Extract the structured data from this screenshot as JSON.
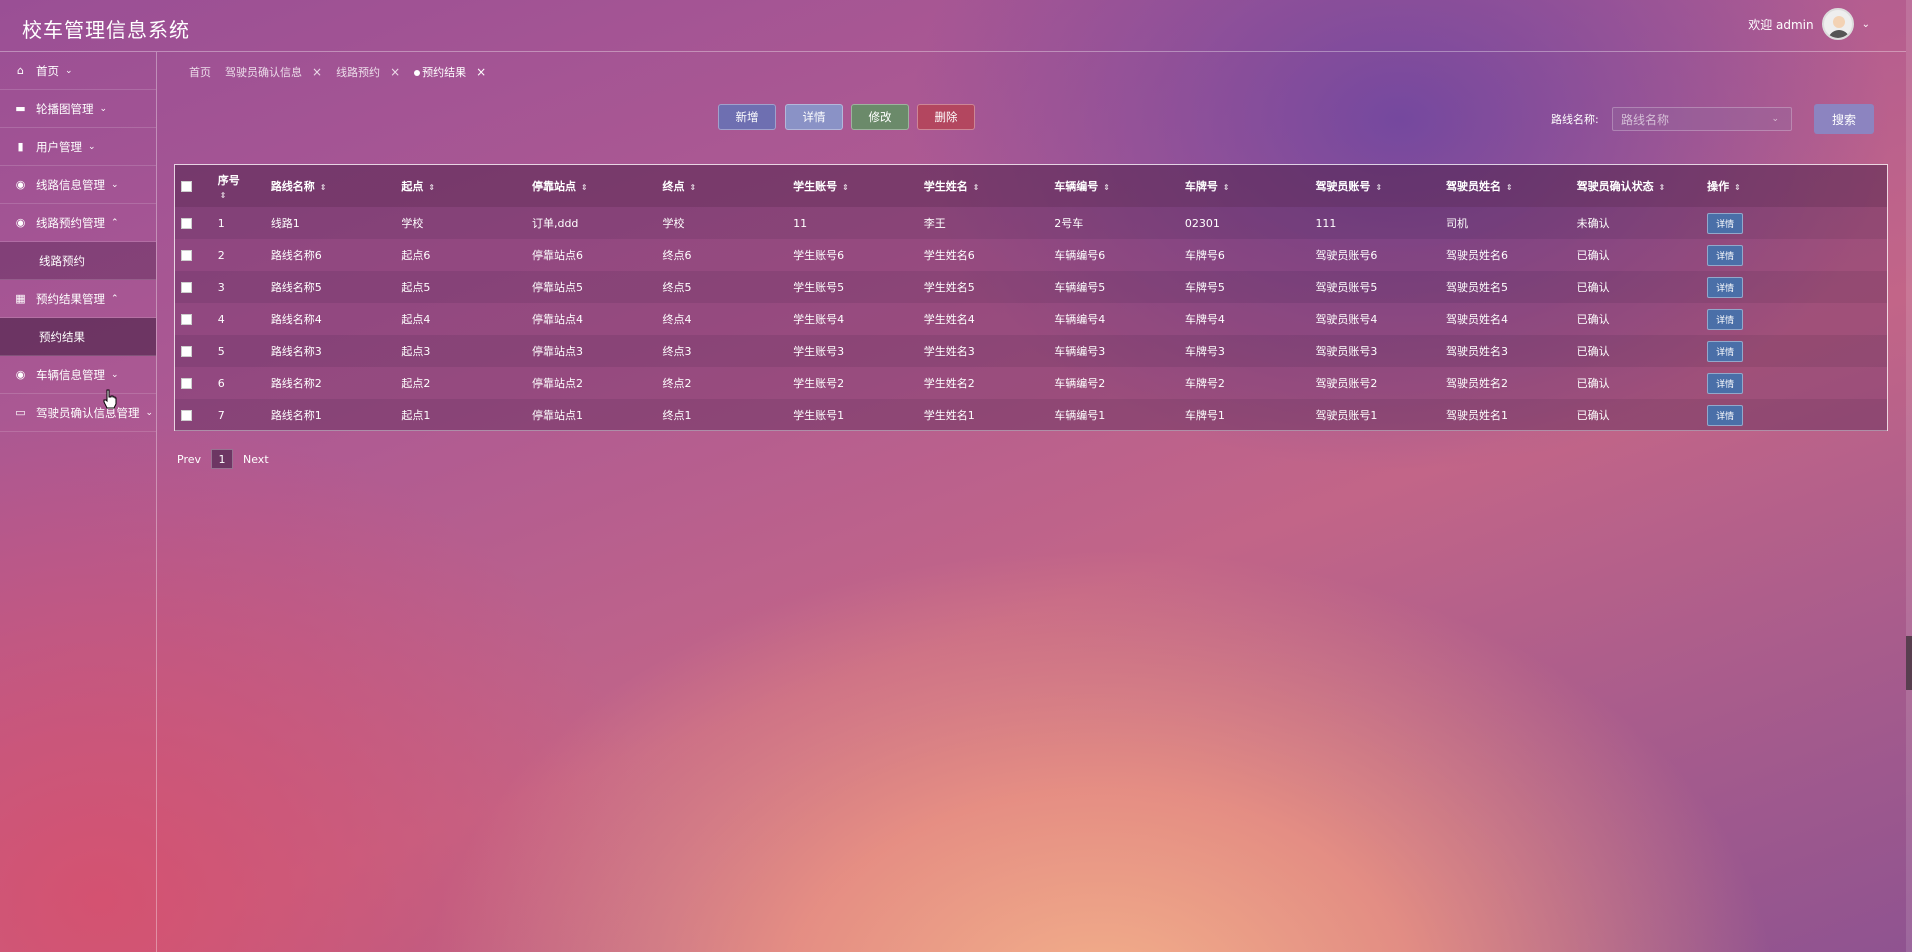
{
  "header": {
    "title": "校车管理信息系统",
    "welcome": "欢迎 admin"
  },
  "sidebar": {
    "items": [
      {
        "label": "首页",
        "icon": "home-icon",
        "arrow": "⌄"
      },
      {
        "label": "轮播图管理",
        "icon": "carousel-icon",
        "arrow": "⌄"
      },
      {
        "label": "用户管理",
        "icon": "user-icon",
        "arrow": "⌄"
      },
      {
        "label": "线路信息管理",
        "icon": "route-icon",
        "arrow": "⌄"
      },
      {
        "label": "线路预约管理",
        "icon": "booking-icon",
        "arrow": "⌃"
      },
      {
        "label": "线路预约",
        "sub": true
      },
      {
        "label": "预约结果管理",
        "icon": "table-icon",
        "arrow": "⌃"
      },
      {
        "label": "预约结果",
        "sub": true
      },
      {
        "label": "车辆信息管理",
        "icon": "vehicle-icon",
        "arrow": "⌄"
      },
      {
        "label": "驾驶员确认信息管理",
        "icon": "driver-icon",
        "arrow": "⌄"
      }
    ]
  },
  "tabs": [
    {
      "label": "首页"
    },
    {
      "label": "驾驶员确认信息"
    },
    {
      "label": "线路预约"
    },
    {
      "label": "预约结果"
    }
  ],
  "toolbar": {
    "add": "新增",
    "detail": "详情",
    "edit": "修改",
    "delete": "删除",
    "search_label": "路线名称:",
    "search_placeholder": "路线名称",
    "search_button": "搜索"
  },
  "table": {
    "columns": [
      "序号",
      "路线名称",
      "起点",
      "停靠站点",
      "终点",
      "学生账号",
      "学生姓名",
      "车辆编号",
      "车牌号",
      "驾驶员账号",
      "驾驶员姓名",
      "驾驶员确认状态",
      "操作"
    ],
    "action_label": "详情",
    "rows": [
      [
        "1",
        "线路1",
        "学校",
        "订单,ddd",
        "学校",
        "11",
        "李王",
        "2号车",
        "02301",
        "111",
        "司机",
        "未确认"
      ],
      [
        "2",
        "路线名称6",
        "起点6",
        "停靠站点6",
        "终点6",
        "学生账号6",
        "学生姓名6",
        "车辆编号6",
        "车牌号6",
        "驾驶员账号6",
        "驾驶员姓名6",
        "已确认"
      ],
      [
        "3",
        "路线名称5",
        "起点5",
        "停靠站点5",
        "终点5",
        "学生账号5",
        "学生姓名5",
        "车辆编号5",
        "车牌号5",
        "驾驶员账号5",
        "驾驶员姓名5",
        "已确认"
      ],
      [
        "4",
        "路线名称4",
        "起点4",
        "停靠站点4",
        "终点4",
        "学生账号4",
        "学生姓名4",
        "车辆编号4",
        "车牌号4",
        "驾驶员账号4",
        "驾驶员姓名4",
        "已确认"
      ],
      [
        "5",
        "路线名称3",
        "起点3",
        "停靠站点3",
        "终点3",
        "学生账号3",
        "学生姓名3",
        "车辆编号3",
        "车牌号3",
        "驾驶员账号3",
        "驾驶员姓名3",
        "已确认"
      ],
      [
        "6",
        "路线名称2",
        "起点2",
        "停靠站点2",
        "终点2",
        "学生账号2",
        "学生姓名2",
        "车辆编号2",
        "车牌号2",
        "驾驶员账号2",
        "驾驶员姓名2",
        "已确认"
      ],
      [
        "7",
        "路线名称1",
        "起点1",
        "停靠站点1",
        "终点1",
        "学生账号1",
        "学生姓名1",
        "车辆编号1",
        "车牌号1",
        "驾驶员账号1",
        "驾驶员姓名1",
        "已确认"
      ]
    ]
  },
  "pager": {
    "prev": "Prev",
    "page": "1",
    "next": "Next"
  }
}
